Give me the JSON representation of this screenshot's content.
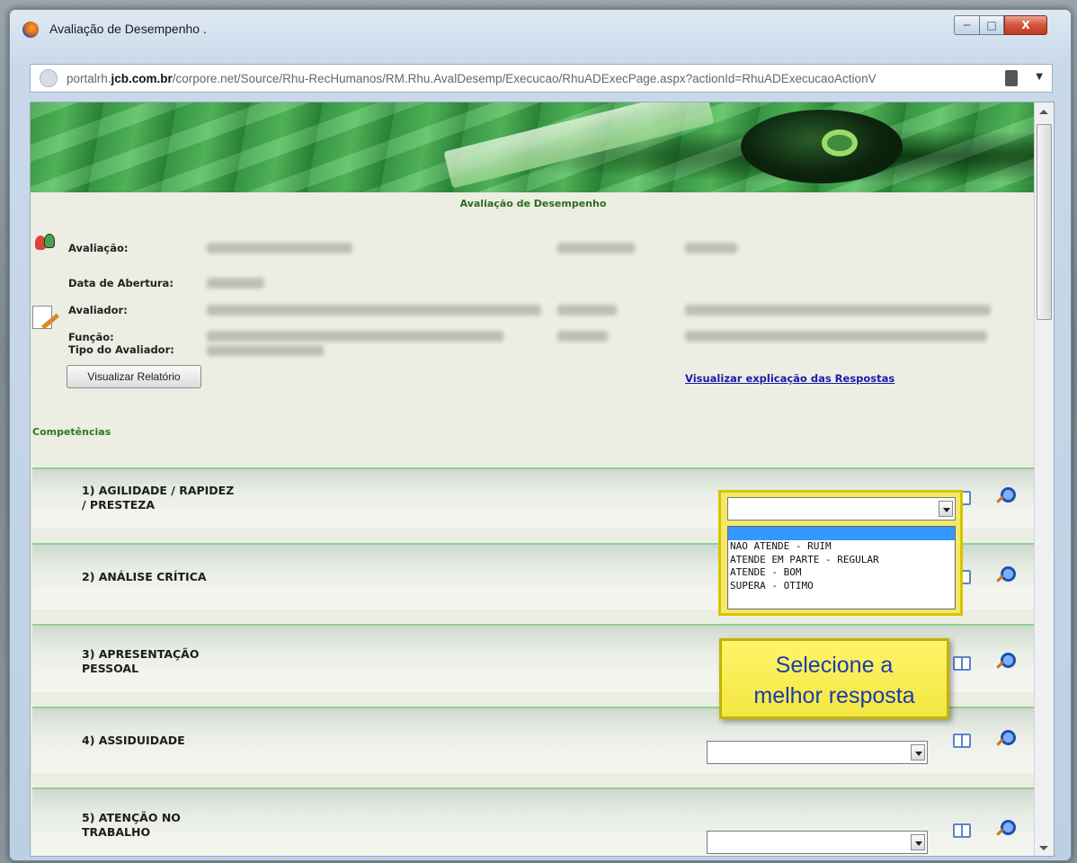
{
  "window": {
    "title": "Avaliação de Desempenho .",
    "minimize": "─",
    "maximize": "□",
    "close": "X"
  },
  "urlbar": {
    "host_prefix": "portalrh.",
    "host_bold": "jcb.com.br",
    "path": "/corpore.net/Source/Rhu-RecHumanos/RM.Rhu.AvalDesemp/Execucao/RhuADExecPage.aspx?actionId=RhuADExecucaoActionV"
  },
  "page": {
    "title": "Avaliação de Desempenho",
    "labels": {
      "avaliacao": "Avaliação:",
      "data_abertura": "Data de Abertura:",
      "avaliador": "Avaliador:",
      "funcao": "Função:",
      "tipo_avaliador": "Tipo do Avaliador:"
    },
    "report_button": "Visualizar Relatório",
    "explain_link": "Visualizar explicação das Respostas",
    "section_title": "Competências"
  },
  "competencies": [
    {
      "label_line1": "1) AGILIDADE / RAPIDEZ",
      "label_line2": "/ PRESTEZA",
      "value": ""
    },
    {
      "label_line1": "2) ANÁLISE CRÍTICA",
      "label_line2": "",
      "value": ""
    },
    {
      "label_line1": "3) APRESENTAÇÃO",
      "label_line2": "PESSOAL",
      "value": ""
    },
    {
      "label_line1": "4) ASSIDUIDADE",
      "label_line2": "",
      "value": ""
    },
    {
      "label_line1": "5) ATENÇÃO NO",
      "label_line2": "TRABALHO",
      "value": ""
    }
  ],
  "dropdown_options": [
    "",
    "NAO ATENDE - RUIM",
    "ATENDE EM PARTE - REGULAR",
    "ATENDE - BOM",
    "SUPERA - OTIMO"
  ],
  "callout": {
    "line1": "Selecione a",
    "line2": "melhor resposta"
  },
  "colors": {
    "accent_green": "#2a7a1c",
    "link": "#1a1aa8",
    "callout_bg": "#f4e640",
    "callout_text": "#1a3da8",
    "highlight": "#3399ff"
  }
}
